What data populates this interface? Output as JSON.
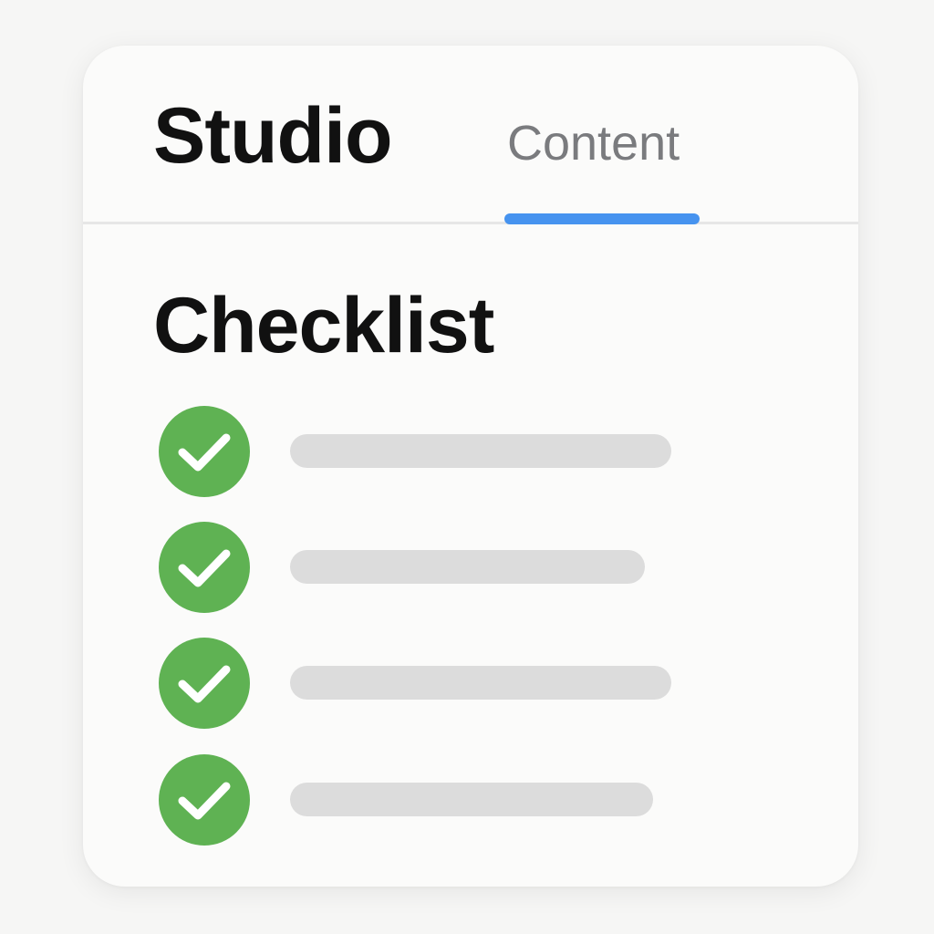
{
  "header": {
    "app_title": "Studio",
    "tabs": [
      {
        "label": "Content",
        "active": true
      }
    ]
  },
  "section": {
    "title": "Checklist"
  },
  "checklist": {
    "items": [
      {
        "checked": true,
        "text": ""
      },
      {
        "checked": true,
        "text": ""
      },
      {
        "checked": true,
        "text": ""
      },
      {
        "checked": true,
        "text": ""
      }
    ]
  },
  "colors": {
    "accent": "#4693ef",
    "check": "#5fb253",
    "placeholder": "#dcdcdc",
    "title": "#111111",
    "tab_text": "#7a7b7e"
  },
  "icons": {
    "item_icon": "check-circle-icon"
  }
}
